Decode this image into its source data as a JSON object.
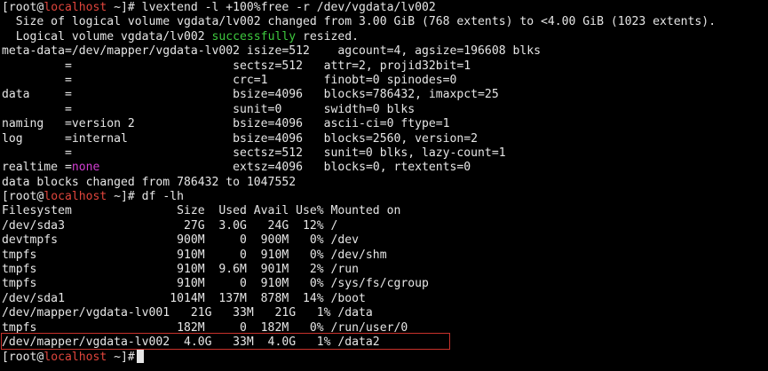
{
  "terminal": {
    "lines": [
      [
        {
          "t": "[root@",
          "c": ""
        },
        {
          "t": "localhost",
          "c": "red"
        },
        {
          "t": " ~]# lvextend -l +100%free -r /dev/vgdata/lv002",
          "c": ""
        }
      ],
      [
        {
          "t": "  Size of logical volume vgdata/lv002 changed from 3.00 GiB (768 extents) to <4.00 GiB (1023 extents).",
          "c": ""
        }
      ],
      [
        {
          "t": "  Logical volume vgdata/lv002 ",
          "c": ""
        },
        {
          "t": "successfully",
          "c": "green"
        },
        {
          "t": " resized.",
          "c": ""
        }
      ],
      [
        {
          "t": "meta-data=/dev/mapper/vgdata-lv002 isize=512    agcount=4, agsize=196608 blks",
          "c": ""
        }
      ],
      [
        {
          "t": "         =                       sectsz=512   attr=2, projid32bit=1",
          "c": ""
        }
      ],
      [
        {
          "t": "         =                       crc=1        finobt=0 spinodes=0",
          "c": ""
        }
      ],
      [
        {
          "t": "data     =                       bsize=4096   blocks=786432, imaxpct=25",
          "c": ""
        }
      ],
      [
        {
          "t": "         =                       sunit=0      swidth=0 blks",
          "c": ""
        }
      ],
      [
        {
          "t": "naming   =version 2              bsize=4096   ascii-ci=0 ftype=1",
          "c": ""
        }
      ],
      [
        {
          "t": "log      =internal               bsize=4096   blocks=2560, version=2",
          "c": ""
        }
      ],
      [
        {
          "t": "         =                       sectsz=512   sunit=0 blks, lazy-count=1",
          "c": ""
        }
      ],
      [
        {
          "t": "realtime =",
          "c": ""
        },
        {
          "t": "none",
          "c": "magenta"
        },
        {
          "t": "                   extsz=4096   blocks=0, rtextents=0",
          "c": ""
        }
      ],
      [
        {
          "t": "data blocks changed from 786432 to 1047552",
          "c": ""
        }
      ],
      [
        {
          "t": "[root@",
          "c": ""
        },
        {
          "t": "localhost",
          "c": "red"
        },
        {
          "t": " ~]# df -lh",
          "c": ""
        }
      ],
      [
        {
          "t": "Filesystem               Size  Used Avail Use% Mounted on",
          "c": ""
        }
      ],
      [
        {
          "t": "/dev/sda3                 27G  3.0G   24G  12% /",
          "c": ""
        }
      ],
      [
        {
          "t": "devtmpfs                 900M     0  900M   0% /dev",
          "c": ""
        }
      ],
      [
        {
          "t": "tmpfs                    910M     0  910M   0% /dev/shm",
          "c": ""
        }
      ],
      [
        {
          "t": "tmpfs                    910M  9.6M  901M   2% /run",
          "c": ""
        }
      ],
      [
        {
          "t": "tmpfs                    910M     0  910M   0% /sys/fs/cgroup",
          "c": ""
        }
      ],
      [
        {
          "t": "/dev/sda1               1014M  137M  878M  14% /boot",
          "c": ""
        }
      ],
      [
        {
          "t": "/dev/mapper/vgdata-lv001   21G   33M   21G   1% /data",
          "c": ""
        }
      ],
      [
        {
          "t": "tmpfs                    182M     0  182M   0% /run/user/0",
          "c": ""
        }
      ],
      [
        {
          "t": "/dev/mapper/vgdata-lv002  4.0G   33M  4.0G   1% /data2",
          "c": ""
        }
      ],
      [
        {
          "t": "[root@",
          "c": ""
        },
        {
          "t": "localhost",
          "c": "red"
        },
        {
          "t": " ~]#",
          "c": ""
        }
      ]
    ],
    "colors": {
      "background": "#000000",
      "foreground": "#e6e6e6",
      "red": "#e0453c",
      "green": "#3ec93e",
      "magenta": "#d43fd4",
      "highlight": "#c8312b"
    }
  }
}
